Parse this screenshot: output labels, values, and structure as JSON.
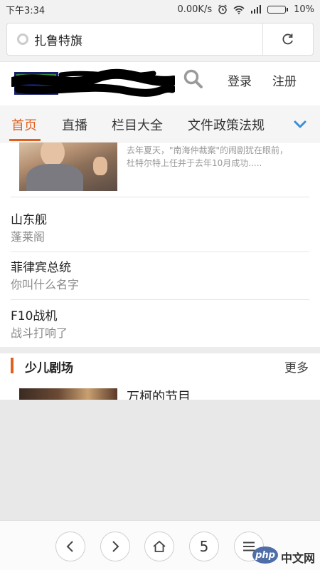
{
  "status_bar": {
    "time": "下午3:34",
    "speed": "0.00K/s",
    "battery_text": "10%",
    "battery_level": 0.1
  },
  "url_bar": {
    "text": "扎鲁特旗"
  },
  "header": {
    "login": "登录",
    "register": "注册"
  },
  "nav": {
    "tabs": [
      "首页",
      "直播",
      "栏目大全",
      "文件政策法规"
    ],
    "active_index": 0
  },
  "feed": {
    "top_item_summary_line1": "去年夏天，\"南海仲裁案\"的闹剧犹在眼前，",
    "top_item_summary_line2": "杜特尔特上任并于去年10月成功.....",
    "items": [
      {
        "title": "山东舰",
        "subtitle": "蓬莱阁"
      },
      {
        "title": "菲律宾总统",
        "subtitle": "你叫什么名字"
      },
      {
        "title": "F10战机",
        "subtitle": "战斗打响了"
      }
    ]
  },
  "section": {
    "title": "少儿剧场",
    "more": "更多",
    "first_item_title": "万柯的节目"
  },
  "bottom_bar": {
    "tab_count": "5"
  },
  "watermark": {
    "badge": "php",
    "text": "中文网"
  },
  "colors": {
    "accent": "#e0601f",
    "link_blue": "#3a8fd8"
  }
}
